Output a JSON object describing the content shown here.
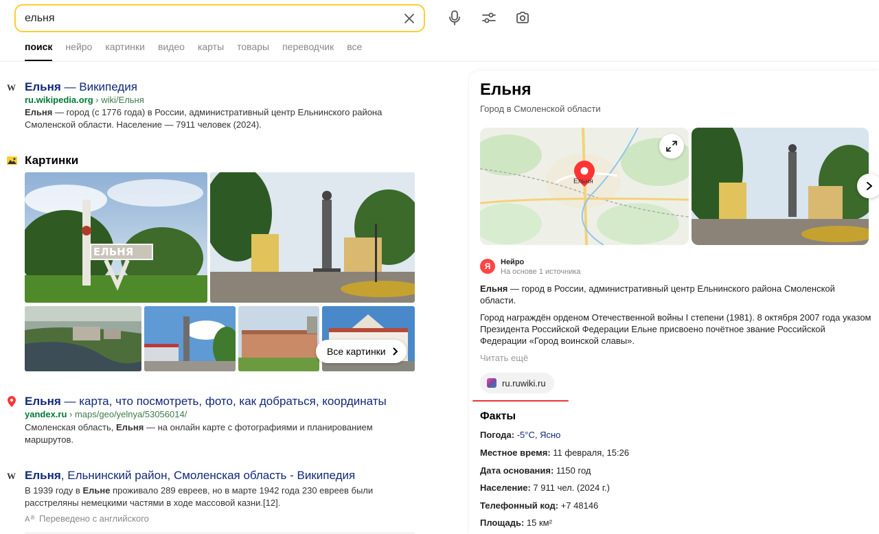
{
  "search": {
    "query": "ельня"
  },
  "tabs": [
    {
      "label": "поиск"
    },
    {
      "label": "нейро"
    },
    {
      "label": "картинки"
    },
    {
      "label": "видео"
    },
    {
      "label": "карты"
    },
    {
      "label": "товары"
    },
    {
      "label": "переводчик"
    },
    {
      "label": "все"
    }
  ],
  "results": [
    {
      "icon": "W",
      "title_bold": "Ельня",
      "title_rest": " — Википедия",
      "url_domain": "ru.wikipedia.org",
      "url_path": " › wiki/Ельня",
      "snippet_bold": "Ельня",
      "snippet_rest": " — город (с 1776 года) в России, административный центр Ельнинского района Смоленской области. Население — 7911 человек (2024)."
    },
    {
      "title_bold": "Ельня",
      "title_rest": " — карта, что посмотреть, фото, как добраться, координаты",
      "url_domain": "yandex.ru",
      "url_path": " › maps/geo/yelnya/53056014/",
      "snippet_pre": "Смоленская область, ",
      "snippet_bold": "Ельня",
      "snippet_rest": " — на онлайн карте с фотографиями и планированием маршрутов."
    },
    {
      "icon": "W",
      "title_bold": "Ельня",
      "title_rest": ", Ельнинский район, Смоленская область - Википедия",
      "snippet_pre": "В 1939 году в ",
      "snippet_bold": "Ельне",
      "snippet_rest": " проживало 289 евреев, но в марте 1942 года 230 евреев были расстреляны немецкими частями в ходе массовой казни.[12].",
      "translated": "Переведено с английского"
    }
  ],
  "images": {
    "heading": "Картинки",
    "all_label": "Все картинки"
  },
  "panel": {
    "title": "Ельня",
    "subtitle": "Город в Смоленской области",
    "map_label": "Ельня",
    "neuro": {
      "name": "Нейро",
      "source_note": "На основе 1 источника",
      "logo_text": "Я"
    },
    "para1_bold": "Ельня",
    "para1_rest": " — город в России, административный центр Ельнинского района Смоленской области.",
    "para2": "Город награждён орденом Отечественной войны I степени (1981). 8 октября 2007 года указом Президента Российской Федерации Ельне присвоено почётное звание Российской Федерации «Город воинской славы».",
    "read_more": "Читать ещё",
    "source_chip": "ru.ruwiki.ru",
    "facts_heading": "Факты",
    "facts": [
      {
        "key": "Погода:",
        "value": " -5°C, Ясно"
      },
      {
        "key": "Местное время:",
        "value": " 11 февраля, 15:26"
      },
      {
        "key": "Дата основания:",
        "value": " 1150 год"
      },
      {
        "key": "Население:",
        "value": " 7 911 чел. (2024 г.)"
      },
      {
        "key": "Телефонный код:",
        "value": " +7 48146"
      },
      {
        "key": "Площадь:",
        "value": " 15 км²"
      }
    ]
  },
  "colors": {
    "search_border": "#ffcc33",
    "link": "#10287a",
    "url": "#007a33",
    "accent_red": "#ee3333"
  }
}
